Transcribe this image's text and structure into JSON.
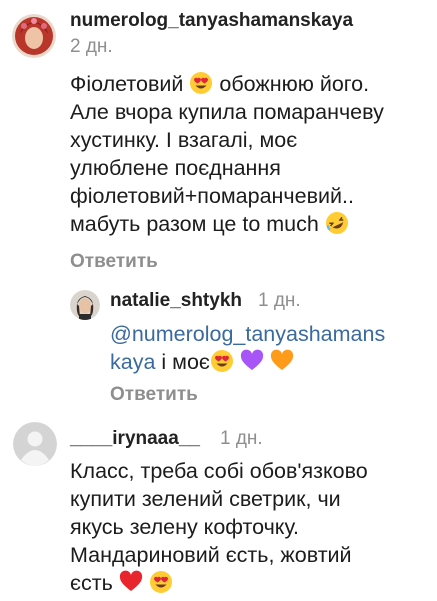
{
  "comments": [
    {
      "username": "numerolog_tanyashamanskaya",
      "time": "2 дн.",
      "lines": [
        "Фіолетовий",
        "обожнюю його.",
        "Але вчора купила помаранчеву",
        "хустинку. І взагалі, моє",
        "улюблене поєднання",
        "фіолетовий+помаранчевий..",
        "мабуть разом це to much"
      ],
      "reply_label": "Ответить"
    },
    {
      "username": "natalie_shtykh",
      "time": "1 дн.",
      "mention_line1": "@numerolog_tanyashamans",
      "mention_line2": "kaya",
      "text_after": "і моє",
      "reply_label": "Ответить"
    },
    {
      "username": "____irynaaa__",
      "time": "1 дн.",
      "lines": [
        "Класс, треба собі обов'язково",
        "купити зелений светрик, чи",
        "якусь зелену кофточку.",
        "Мандариновий єсть, жовтий",
        "єсть"
      ]
    }
  ],
  "icons": {
    "heart_eyes": "heart-eyes-emoji",
    "rofl": "rolling-laughing-emoji",
    "purple_heart": "purple-heart-emoji",
    "orange_heart": "orange-heart-emoji",
    "red_heart": "red-heart-emoji"
  },
  "colors": {
    "mention": "#3b6a9e",
    "meta": "#8e8e8e"
  }
}
